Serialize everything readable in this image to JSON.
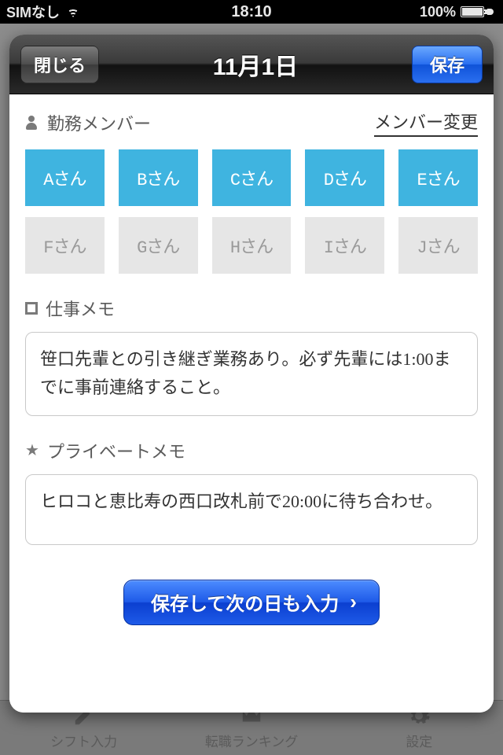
{
  "status": {
    "carrier": "SIMなし",
    "time": "18:10",
    "battery": "100%"
  },
  "tabbar": {
    "items": [
      {
        "label": "シフト入力"
      },
      {
        "label": "転職ランキング"
      },
      {
        "label": "設定"
      }
    ]
  },
  "modal": {
    "close_label": "閉じる",
    "title": "11月1日",
    "save_label": "保存",
    "section_members_label": "勤務メンバー",
    "member_change_label": "メンバー変更",
    "members": [
      {
        "label": "Aさん",
        "active": true
      },
      {
        "label": "Bさん",
        "active": true
      },
      {
        "label": "Cさん",
        "active": true
      },
      {
        "label": "Dさん",
        "active": true
      },
      {
        "label": "Eさん",
        "active": true
      },
      {
        "label": "Fさん",
        "active": false
      },
      {
        "label": "Gさん",
        "active": false
      },
      {
        "label": "Hさん",
        "active": false
      },
      {
        "label": "Iさん",
        "active": false
      },
      {
        "label": "Jさん",
        "active": false
      }
    ],
    "section_work_memo_label": "仕事メモ",
    "work_memo": "笹口先輩との引き継ぎ業務あり。必ず先輩には1:00までに事前連絡すること。",
    "section_private_memo_label": "プライベートメモ",
    "private_memo": "ヒロコと恵比寿の西口改札前で20:00に待ち合わせ。",
    "next_day_label": "保存して次の日も入力"
  }
}
